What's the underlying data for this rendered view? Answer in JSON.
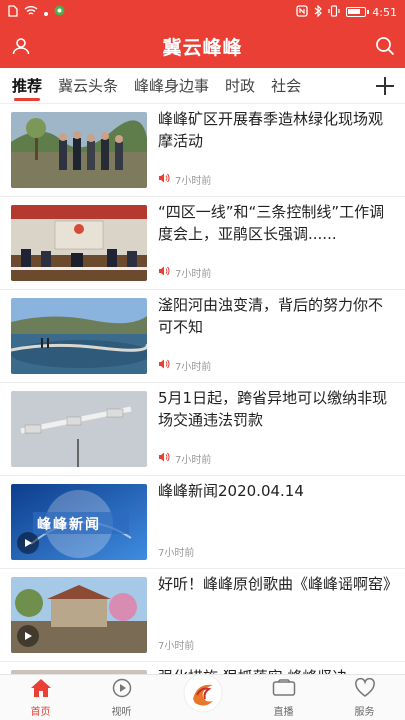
{
  "status_bar": {
    "time": "4:51",
    "icons": [
      "sim-icon",
      "wifi-icon",
      "dot-icon",
      "app-icon",
      "nfc-icon",
      "bluetooth-icon",
      "vibrate-icon",
      "battery-icon"
    ],
    "battery_level": 0.8
  },
  "header": {
    "title": "冀云峰峰",
    "left_icon": "user-icon",
    "right_icon": "search-icon",
    "color": "#ea3f34"
  },
  "tabs": [
    {
      "label": "推荐",
      "active": true
    },
    {
      "label": "冀云头条",
      "active": false
    },
    {
      "label": "峰峰身边事",
      "active": false
    },
    {
      "label": "时政",
      "active": false
    },
    {
      "label": "社会",
      "active": false
    }
  ],
  "news": [
    {
      "title": "峰峰矿区开展春季造林绿化现场观摩活动",
      "time": "7小时前",
      "audio": true,
      "video": false
    },
    {
      "title": "“四区一线”和“三条控制线”工作调度会上，亚鹃区长强调......",
      "time": "7小时前",
      "audio": true,
      "video": false
    },
    {
      "title": "滏阳河由浊变清，背后的努力你不可不知",
      "time": "7小时前",
      "audio": true,
      "video": false
    },
    {
      "title": "5月1日起，跨省异地可以缴纳非现场交通违法罚款",
      "time": "7小时前",
      "audio": true,
      "video": false
    },
    {
      "title": "峰峰新闻2020.04.14",
      "time": "7小时前",
      "audio": false,
      "video": true,
      "overlay": "峰峰新闻"
    },
    {
      "title": "好听！峰峰原创歌曲《峰峰谣啊窑》",
      "time": "7小时前",
      "audio": false,
      "video": true
    },
    {
      "title": "强化措施 狠抓落实 峰峰坚决",
      "time": "",
      "audio": false,
      "video": false
    }
  ],
  "bottom_nav": [
    {
      "label": "首页",
      "icon": "home-icon",
      "active": true
    },
    {
      "label": "视听",
      "icon": "play-circle-icon",
      "active": false
    },
    {
      "label": "",
      "icon": "brand-logo-icon",
      "active": false
    },
    {
      "label": "直播",
      "icon": "camera-icon",
      "active": false
    },
    {
      "label": "服务",
      "icon": "heart-icon",
      "active": false
    }
  ]
}
